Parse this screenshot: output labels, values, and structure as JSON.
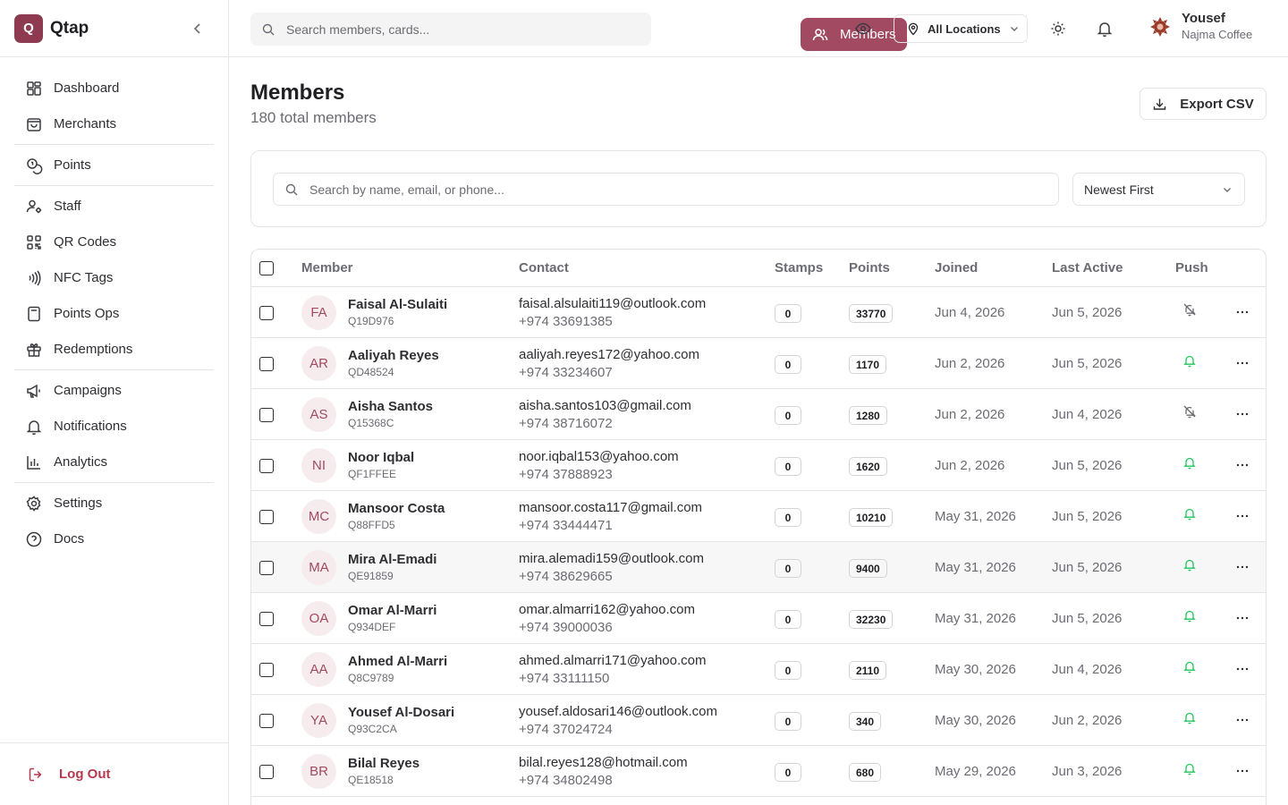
{
  "brand": {
    "logo_letter": "Q",
    "name": "Qtap"
  },
  "sidebar": {
    "items": [
      {
        "label": "Dashboard",
        "icon": "dashboard-icon"
      },
      {
        "label": "Merchants",
        "icon": "shopping-bag-icon"
      },
      {
        "label": "Members",
        "icon": "users-icon",
        "active": true
      },
      {
        "label": "Points",
        "icon": "coins-icon"
      },
      {
        "label": "Staff",
        "icon": "user-cog-icon"
      },
      {
        "label": "QR Codes",
        "icon": "qr-code-icon"
      },
      {
        "label": "NFC Tags",
        "icon": "nfc-icon"
      },
      {
        "label": "Points Ops",
        "icon": "calculator-icon"
      },
      {
        "label": "Redemptions",
        "icon": "gift-icon"
      },
      {
        "label": "Campaigns",
        "icon": "megaphone-icon"
      },
      {
        "label": "Notifications",
        "icon": "bell-icon"
      },
      {
        "label": "Analytics",
        "icon": "bar-chart-icon"
      },
      {
        "label": "Settings",
        "icon": "gear-icon"
      },
      {
        "label": "Docs",
        "icon": "help-circle-icon"
      }
    ],
    "logout_label": "Log Out"
  },
  "topbar": {
    "search_placeholder": "Search members, cards...",
    "location_label": "All Locations",
    "user_name": "Yousef",
    "user_org": "Najma Coffee"
  },
  "page": {
    "title": "Members",
    "subtitle": "180 total members",
    "export_label": "Export CSV",
    "search_placeholder": "Search by name, email, or phone...",
    "sort_label": "Newest First"
  },
  "table": {
    "columns": [
      "Member",
      "Contact",
      "Stamps",
      "Points",
      "Joined",
      "Last Active",
      "Push"
    ],
    "rows": [
      {
        "initials": "FA",
        "name": "Faisal Al-Sulaiti",
        "code": "Q19D976",
        "email": "faisal.alsulaiti119@outlook.com",
        "phone": "+974 33691385",
        "stamps": "0",
        "points": "33770",
        "joined": "Jun 4, 2026",
        "last_active": "Jun 5, 2026",
        "push": "off"
      },
      {
        "initials": "AR",
        "name": "Aaliyah Reyes",
        "code": "QD48524",
        "email": "aaliyah.reyes172@yahoo.com",
        "phone": "+974 33234607",
        "stamps": "0",
        "points": "1170",
        "joined": "Jun 2, 2026",
        "last_active": "Jun 5, 2026",
        "push": "on"
      },
      {
        "initials": "AS",
        "name": "Aisha Santos",
        "code": "Q15368C",
        "email": "aisha.santos103@gmail.com",
        "phone": "+974 38716072",
        "stamps": "0",
        "points": "1280",
        "joined": "Jun 2, 2026",
        "last_active": "Jun 4, 2026",
        "push": "off"
      },
      {
        "initials": "NI",
        "name": "Noor Iqbal",
        "code": "QF1FFEE",
        "email": "noor.iqbal153@yahoo.com",
        "phone": "+974 37888923",
        "stamps": "0",
        "points": "1620",
        "joined": "Jun 2, 2026",
        "last_active": "Jun 5, 2026",
        "push": "on"
      },
      {
        "initials": "MC",
        "name": "Mansoor Costa",
        "code": "Q88FFD5",
        "email": "mansoor.costa117@gmail.com",
        "phone": "+974 33444471",
        "stamps": "0",
        "points": "10210",
        "joined": "May 31, 2026",
        "last_active": "Jun 5, 2026",
        "push": "on"
      },
      {
        "initials": "MA",
        "name": "Mira Al-Emadi",
        "code": "QE91859",
        "email": "mira.alemadi159@outlook.com",
        "phone": "+974 38629665",
        "stamps": "0",
        "points": "9400",
        "joined": "May 31, 2026",
        "last_active": "Jun 5, 2026",
        "push": "on"
      },
      {
        "initials": "OA",
        "name": "Omar Al-Marri",
        "code": "Q934DEF",
        "email": "omar.almarri162@yahoo.com",
        "phone": "+974 39000036",
        "stamps": "0",
        "points": "32230",
        "joined": "May 31, 2026",
        "last_active": "Jun 5, 2026",
        "push": "on"
      },
      {
        "initials": "AA",
        "name": "Ahmed Al-Marri",
        "code": "Q8C9789",
        "email": "ahmed.almarri171@yahoo.com",
        "phone": "+974 33111150",
        "stamps": "0",
        "points": "2110",
        "joined": "May 30, 2026",
        "last_active": "Jun 4, 2026",
        "push": "on"
      },
      {
        "initials": "YA",
        "name": "Yousef Al-Dosari",
        "code": "Q93C2CA",
        "email": "yousef.aldosari146@outlook.com",
        "phone": "+974 37024724",
        "stamps": "0",
        "points": "340",
        "joined": "May 30, 2026",
        "last_active": "Jun 2, 2026",
        "push": "on"
      },
      {
        "initials": "BR",
        "name": "Bilal Reyes",
        "code": "QE18518",
        "email": "bilal.reyes128@hotmail.com",
        "phone": "+974 34802498",
        "stamps": "0",
        "points": "680",
        "joined": "May 29, 2026",
        "last_active": "Jun 3, 2026",
        "push": "on"
      }
    ]
  },
  "colors": {
    "accent": "#a14a62",
    "brand": "#8e3b52",
    "push_on": "#22c55e",
    "logout": "#b43a4e"
  }
}
